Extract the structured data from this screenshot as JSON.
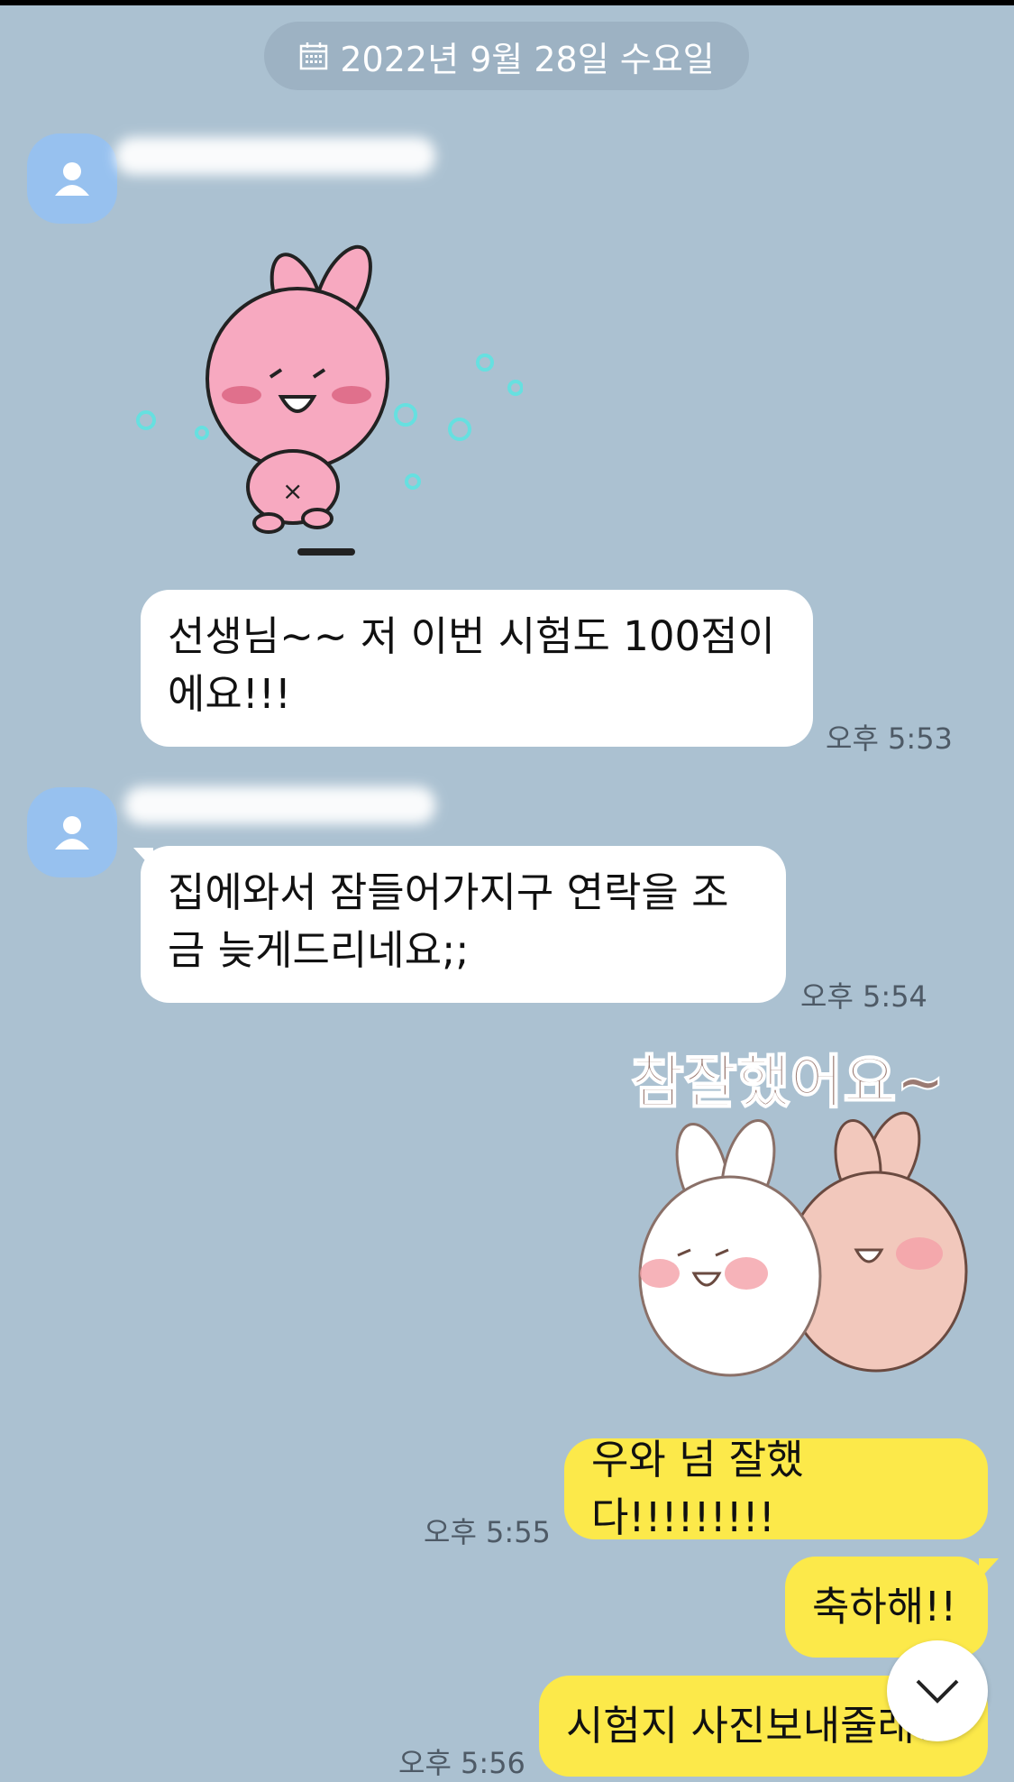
{
  "date_header": "2022년 9월 28일 수요일",
  "messages": [
    {
      "side": "in",
      "type": "sticker",
      "sticker": "pink-bunny-dancing"
    },
    {
      "side": "in",
      "type": "text",
      "lines": [
        "선생님~~ 저 이번 시험도 100점이",
        "에요!!!"
      ],
      "time": "오후 5:53"
    },
    {
      "side": "in",
      "type": "text",
      "lines": [
        "집에와서 잠들어가지구 연락을 조",
        "금 늦게드리네요;;"
      ],
      "time": "오후 5:54"
    },
    {
      "side": "out",
      "type": "sticker",
      "sticker": "two-bunnies-hug",
      "caption": "참잘했어요~"
    },
    {
      "side": "out",
      "type": "text",
      "text": "우와 넘 잘했다!!!!!!!!!",
      "time": "오후 5:55"
    },
    {
      "side": "out",
      "type": "text",
      "text": "축하해!!"
    },
    {
      "side": "out",
      "type": "text",
      "text": "시험지 사진보내줄래?",
      "time": "오후 5:56"
    }
  ],
  "icons": {
    "calendar": "calendar-icon",
    "avatar": "default-profile-icon",
    "scroll": "chevron-down-icon"
  },
  "colors": {
    "background": "#abc1d1",
    "incoming_bubble": "#ffffff",
    "outgoing_bubble": "#fce94a",
    "avatar": "#97c1ef"
  }
}
